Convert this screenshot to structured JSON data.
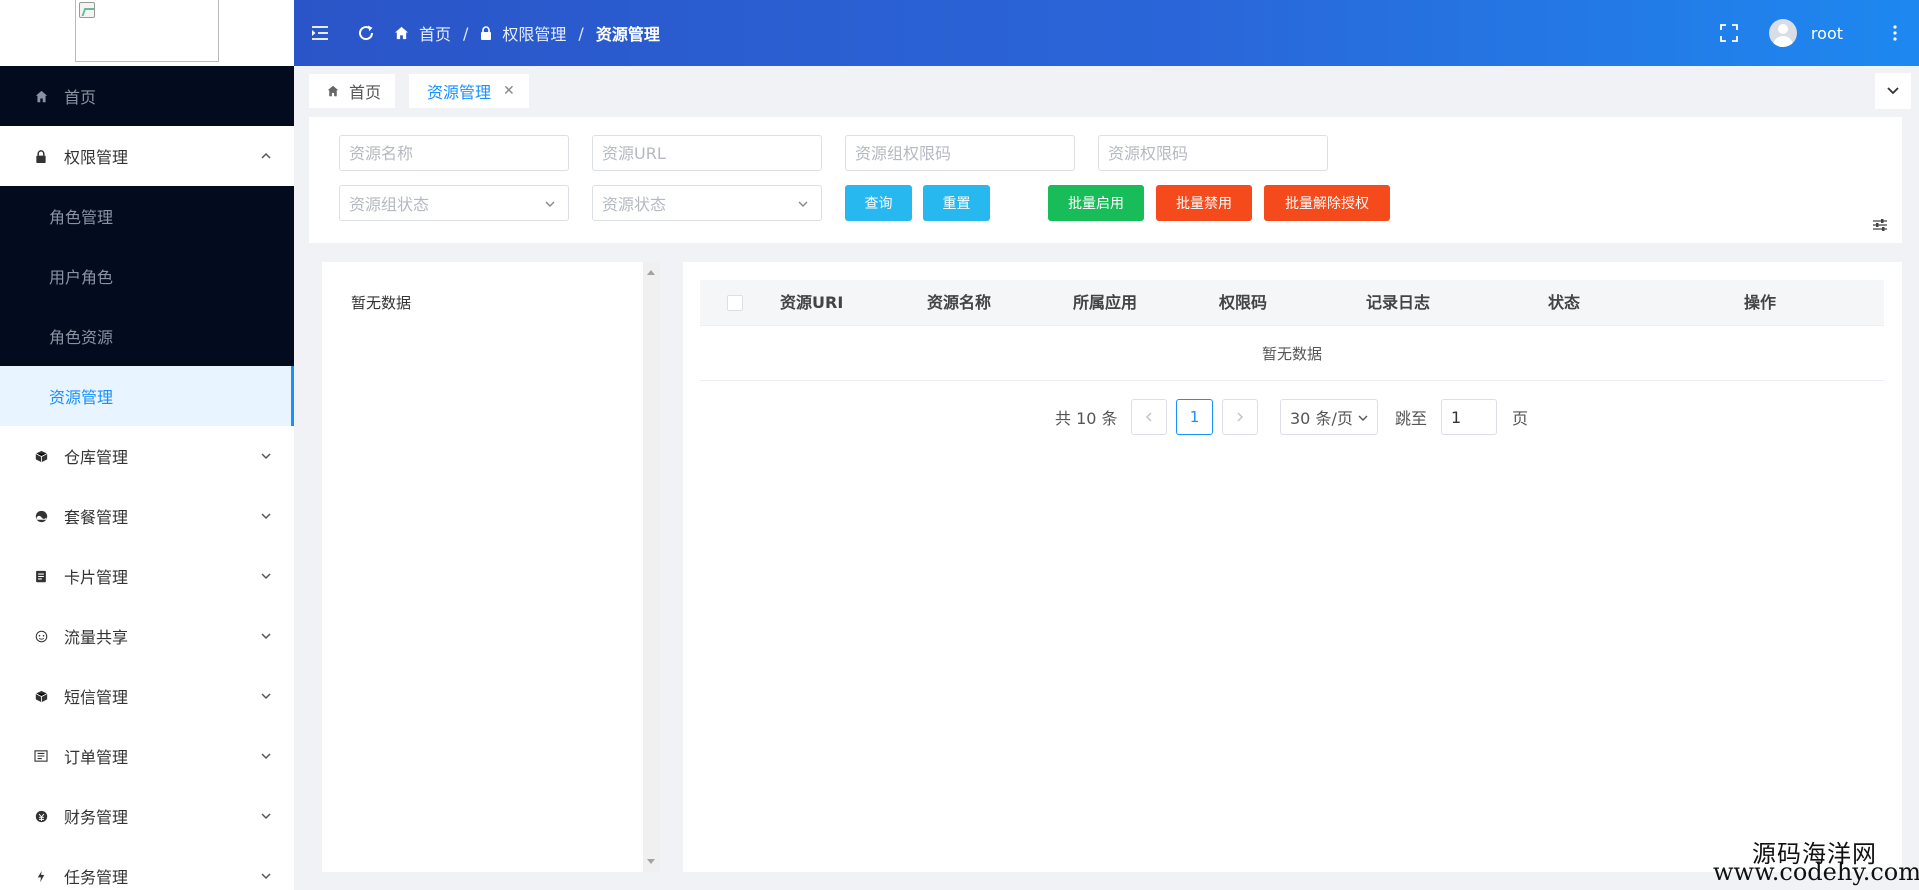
{
  "sidebar": {
    "items": [
      {
        "label": "首页",
        "icon": "home-icon"
      },
      {
        "label": "权限管理",
        "icon": "lock-icon",
        "expanded": true,
        "children": [
          {
            "label": "角色管理"
          },
          {
            "label": "用户角色"
          },
          {
            "label": "角色资源"
          },
          {
            "label": "资源管理",
            "active": true
          }
        ]
      },
      {
        "label": "仓库管理",
        "icon": "box-icon"
      },
      {
        "label": "套餐管理",
        "icon": "package-icon"
      },
      {
        "label": "卡片管理",
        "icon": "card-icon"
      },
      {
        "label": "流量共享",
        "icon": "share-icon"
      },
      {
        "label": "短信管理",
        "icon": "message-icon"
      },
      {
        "label": "订单管理",
        "icon": "order-icon"
      },
      {
        "label": "财务管理",
        "icon": "finance-icon"
      },
      {
        "label": "任务管理",
        "icon": "task-icon"
      }
    ]
  },
  "header": {
    "breadcrumb": [
      "首页",
      "权限管理",
      "资源管理"
    ],
    "separator": "/",
    "username": "root"
  },
  "tabs": [
    {
      "label": "首页",
      "icon": "home-icon",
      "active": false
    },
    {
      "label": "资源管理",
      "active": true,
      "close": "✕"
    }
  ],
  "filter": {
    "resource_name_placeholder": "资源名称",
    "resource_url_placeholder": "资源URL",
    "group_code_placeholder": "资源组权限码",
    "perm_code_placeholder": "资源权限码",
    "group_status_placeholder": "资源组状态",
    "resource_status_placeholder": "资源状态",
    "query_label": "查询",
    "reset_label": "重置",
    "batch_enable_label": "批量启用",
    "batch_disable_label": "批量禁用",
    "batch_unauth_label": "批量解除授权"
  },
  "tree": {
    "empty_text": "暂无数据"
  },
  "table": {
    "columns": [
      "资源URI",
      "资源名称",
      "所属应用",
      "权限码",
      "记录日志",
      "状态",
      "操作"
    ],
    "empty_text": "暂无数据"
  },
  "pagination": {
    "total_text": "共 10 条",
    "current_page": "1",
    "page_size": "30 条/页",
    "jump_label": "跳至",
    "jump_value": "1",
    "page_suffix": "页"
  },
  "watermark": {
    "line1": "源码海洋网",
    "line2": "www.codehy.com"
  },
  "colors": {
    "accent": "#1890ff",
    "header_start": "#2a55c8",
    "header_end": "#1e88f0",
    "sidebar_dark": "#030b1f",
    "btn_blue": "#27b8f0",
    "btn_green": "#18bd5a",
    "btn_red": "#f54a1b"
  }
}
